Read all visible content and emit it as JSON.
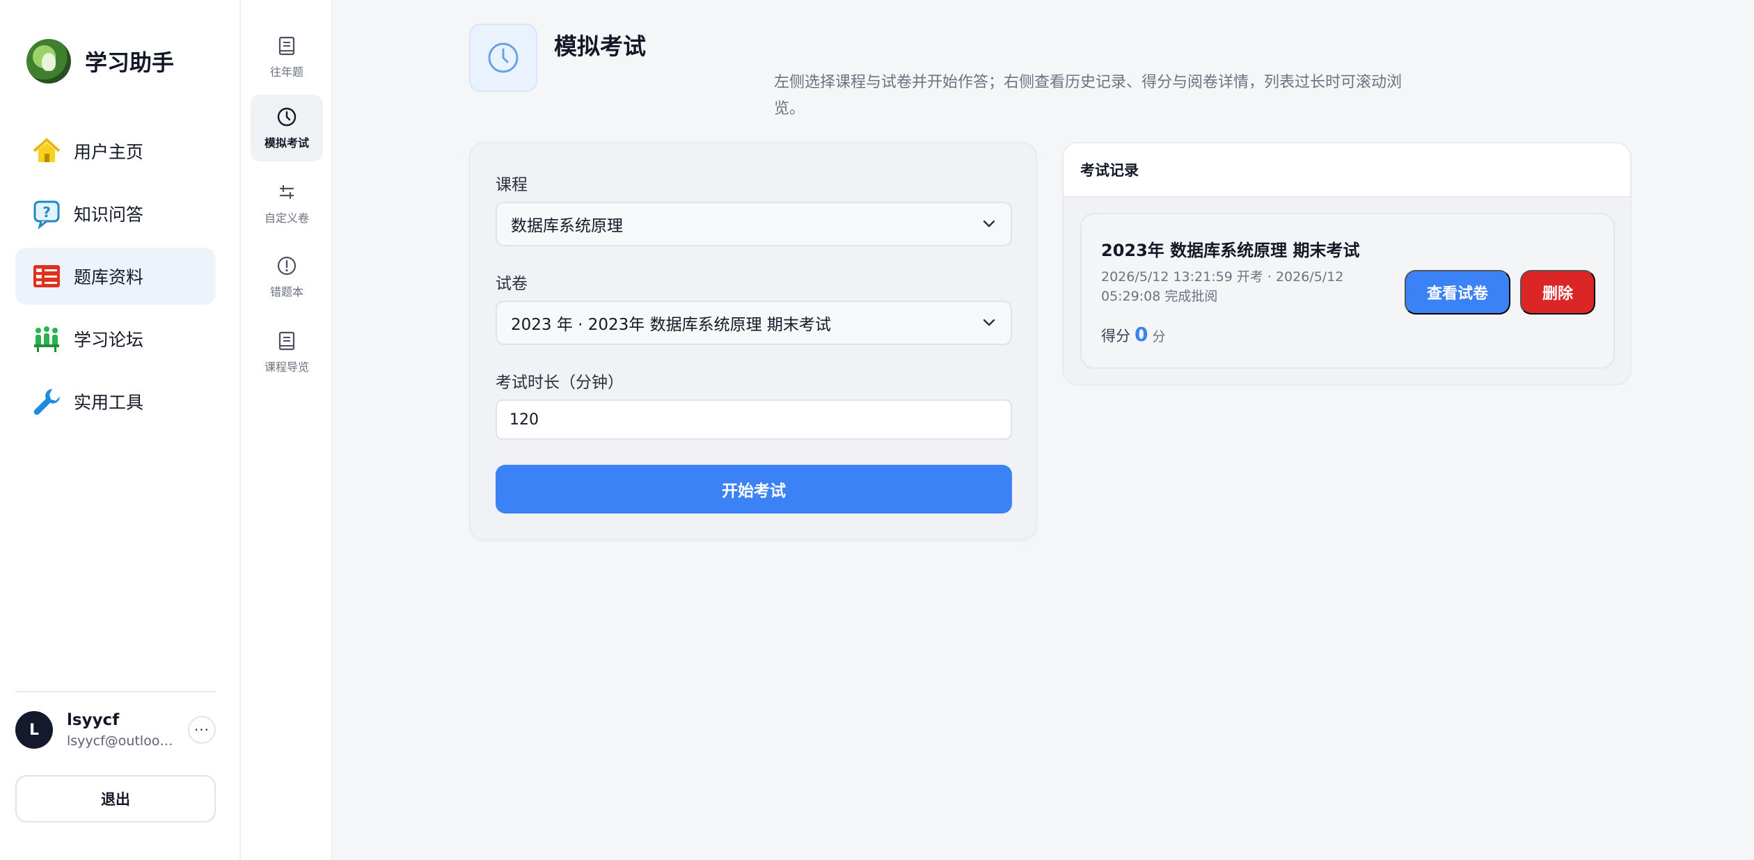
{
  "brand": {
    "title": "学习助手"
  },
  "nav": {
    "items": [
      {
        "label": "用户主页",
        "icon": "home-icon",
        "color": "#f6d21e"
      },
      {
        "label": "知识问答",
        "icon": "question-bubble-icon",
        "color": "#1f8ac0"
      },
      {
        "label": "题库资料",
        "icon": "question-bank-icon",
        "color": "#e0301e"
      },
      {
        "label": "学习论坛",
        "icon": "forum-people-icon",
        "color": "#2bb24c"
      },
      {
        "label": "实用工具",
        "icon": "wrench-icon",
        "color": "#1d8be0"
      }
    ],
    "active_index": 2
  },
  "user": {
    "initial": "L",
    "name": "lsyycf",
    "email": "lsyycf@outlook.com",
    "more": "···"
  },
  "logout_label": "退出",
  "subnav": {
    "items": [
      {
        "label": "往年题",
        "icon": "book-icon"
      },
      {
        "label": "模拟考试",
        "icon": "clock-icon"
      },
      {
        "label": "自定义卷",
        "icon": "custom-paper-icon"
      },
      {
        "label": "错题本",
        "icon": "alert-circle-icon"
      },
      {
        "label": "课程导览",
        "icon": "book-icon"
      }
    ],
    "active_index": 1
  },
  "page": {
    "title": "模拟考试",
    "description": "左侧选择课程与试卷并开始作答；右侧查看历史记录、得分与阅卷详情，列表过长时可滚动浏览。"
  },
  "form": {
    "course_label": "课程",
    "course_value": "数据库系统原理",
    "paper_label": "试卷",
    "paper_value": "2023 年 · 2023年 数据库系统原理 期末考试",
    "duration_label": "考试时长（分钟）",
    "duration_value": "120",
    "start_label": "开始考试"
  },
  "records": {
    "title": "考试记录",
    "items": [
      {
        "title": "2023年 数据库系统原理 期末考试",
        "meta": "2026/5/12 13:21:59 开考 · 2026/5/12 05:29:08 完成批阅",
        "score_label": "得分",
        "score": "0",
        "score_unit": "分",
        "view_label": "查看试卷",
        "delete_label": "删除"
      }
    ]
  },
  "colors": {
    "primary": "#3b82f6",
    "danger": "#dc2626",
    "active_bg": "#eef3fb"
  }
}
